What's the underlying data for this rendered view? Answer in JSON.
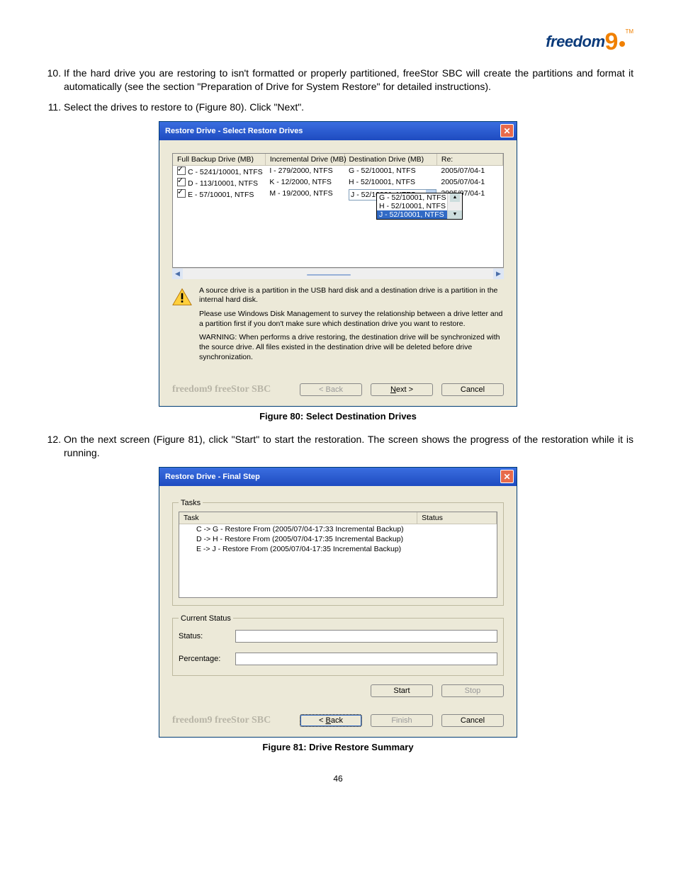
{
  "logo": {
    "word": "freedom",
    "digit": "9",
    "tm": "TM"
  },
  "para10": "If the hard drive you are restoring to isn't formatted or properly partitioned, freeStor SBC will create the partitions and format it automatically (see the section \"Preparation of Drive for System Restore\" for detailed instructions).",
  "para11": "Select the drives to restore to (Figure 80).  Click \"Next\".",
  "para12": "On the next screen (Figure 81), click \"Start\" to start the restoration.  The screen shows the progress of the restoration while it is running.",
  "fig80_caption": "Figure 80: Select Destination Drives",
  "fig81_caption": "Figure 81: Drive Restore Summary",
  "page_number": "46",
  "dlg1": {
    "title": "Restore Drive - Select Restore Drives",
    "headers": {
      "col1": "Full Backup Drive (MB)",
      "col2": "Incremental Drive (MB)",
      "col3": "Destination Drive (MB)",
      "col4": "Re:"
    },
    "rows": [
      {
        "full": "C - 5241/10001, NTFS",
        "inc": "I - 279/2000, NTFS",
        "dest": "G - 52/10001, NTFS",
        "re": "2005/07/04-1"
      },
      {
        "full": "D - 113/10001, NTFS",
        "inc": "K - 12/2000, NTFS",
        "dest": "H - 52/10001, NTFS",
        "re": "2005/07/04-1"
      },
      {
        "full": "E - 57/10001, NTFS",
        "inc": "M - 19/2000, NTFS",
        "dest": "J - 52/10001, NTFS",
        "re": "2005/07/04-1"
      }
    ],
    "dropdown": [
      "G - 52/10001, NTFS",
      "H - 52/10001, NTFS",
      "J - 52/10001, NTFS"
    ],
    "info1": "A source drive is a partition in the USB hard disk and a destination drive is a partition in the internal hard disk.",
    "info2": "Please use Windows Disk Management to survey the relationship between a drive letter and a partition first if you don't make sure which destination drive you want to restore.",
    "info3": "WARNING: When performs a drive restoring, the destination drive will be synchronized with the source drive.  All files existed in the destination drive will be deleted before drive synchronization.",
    "brand": "freedom9 freeStor SBC",
    "buttons": {
      "back": "< Back",
      "next": "Next >",
      "cancel": "Cancel"
    }
  },
  "dlg2": {
    "title": "Restore Drive - Final Step",
    "tasks_legend": "Tasks",
    "task_header": "Task",
    "status_header": "Status",
    "tasks": [
      "C -> G - Restore From (2005/07/04-17:33 Incremental Backup)",
      "D -> H - Restore From (2005/07/04-17:35 Incremental Backup)",
      "E -> J - Restore From (2005/07/04-17:35 Incremental Backup)"
    ],
    "current_status_legend": "Current Status",
    "status_label": "Status:",
    "percentage_label": "Percentage:",
    "start": "Start",
    "stop": "Stop",
    "brand": "freedom9 freeStor SBC",
    "buttons": {
      "back": "< Back",
      "finish": "Finish",
      "cancel": "Cancel"
    }
  }
}
